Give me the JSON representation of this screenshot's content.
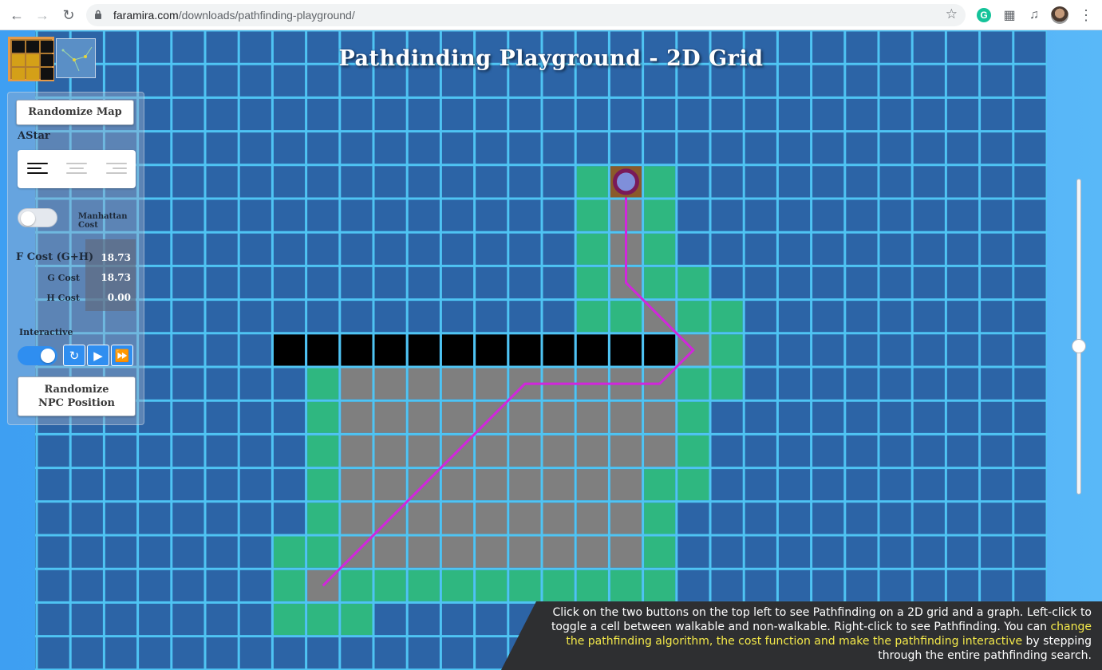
{
  "browser": {
    "url_domain": "faramira.com",
    "url_path": "/downloads/pathfinding-playground/",
    "extension_g": "G"
  },
  "page": {
    "title": "Pathdinding Playground - 2D Grid"
  },
  "panel": {
    "randomize_map_label": "Randomize Map",
    "algorithm_label": "AStar",
    "algorithm_selected": "left",
    "manhattan_label": "Manhattan Cost",
    "manhattan_enabled": false,
    "f_cost_label": "F Cost (G+H)",
    "g_cost_label": "G Cost",
    "h_cost_label": "H Cost",
    "f_cost_value": "18.73",
    "g_cost_value": "18.73",
    "h_cost_value": "0.00",
    "interactive_label": "Interactive",
    "interactive_enabled": true,
    "randomize_npc_line1": "Randomize",
    "randomize_npc_line2": "NPC Position"
  },
  "info": {
    "text_1": "Click on the two buttons on the top left to see Pathfinding on a 2D grid and a graph. Left-click to toggle a cell between walkable and non-walkable. Right-click to see Pathfinding. You can ",
    "text_highlight": "change the pathfinding algorithm, the cost function and make the pathfinding interactive",
    "text_2": " by stepping through the entire pathfinding search."
  },
  "colors": {
    "walkable": "#2c64a6",
    "open": "#2fb780",
    "closed": "#7f7f7f",
    "wall": "#000000",
    "grid_line": "#4fc4f3",
    "path": "#d126dc",
    "npc_fill": "#7f8fda",
    "npc_ring": "#7a1a58"
  },
  "grid": {
    "cols": 30,
    "rows": 19,
    "open": [
      [
        16,
        4
      ],
      [
        18,
        4
      ],
      [
        16,
        5
      ],
      [
        18,
        5
      ],
      [
        16,
        6
      ],
      [
        18,
        6
      ],
      [
        16,
        7
      ],
      [
        18,
        7
      ],
      [
        19,
        7
      ],
      [
        16,
        8
      ],
      [
        17,
        8
      ],
      [
        19,
        8
      ],
      [
        20,
        8
      ],
      [
        19,
        9
      ],
      [
        20,
        9
      ],
      [
        8,
        10
      ],
      [
        19,
        10
      ],
      [
        20,
        10
      ],
      [
        8,
        11
      ],
      [
        19,
        11
      ],
      [
        8,
        12
      ],
      [
        19,
        12
      ],
      [
        8,
        13
      ],
      [
        18,
        13
      ],
      [
        19,
        13
      ],
      [
        8,
        14
      ],
      [
        18,
        14
      ],
      [
        7,
        15
      ],
      [
        8,
        15
      ],
      [
        18,
        15
      ],
      [
        7,
        16
      ],
      [
        9,
        16
      ],
      [
        10,
        16
      ],
      [
        11,
        16
      ],
      [
        12,
        16
      ],
      [
        13,
        16
      ],
      [
        14,
        16
      ],
      [
        15,
        16
      ],
      [
        16,
        16
      ],
      [
        17,
        16
      ],
      [
        18,
        16
      ],
      [
        7,
        17
      ],
      [
        8,
        17
      ],
      [
        9,
        17
      ]
    ],
    "closed": [
      [
        17,
        5
      ],
      [
        17,
        6
      ],
      [
        17,
        7
      ],
      [
        18,
        8
      ],
      [
        19,
        9
      ],
      [
        9,
        10
      ],
      [
        10,
        10
      ],
      [
        11,
        10
      ],
      [
        12,
        10
      ],
      [
        13,
        10
      ],
      [
        14,
        10
      ],
      [
        15,
        10
      ],
      [
        16,
        10
      ],
      [
        17,
        10
      ],
      [
        18,
        10
      ],
      [
        9,
        11
      ],
      [
        10,
        11
      ],
      [
        11,
        11
      ],
      [
        12,
        11
      ],
      [
        13,
        11
      ],
      [
        14,
        11
      ],
      [
        15,
        11
      ],
      [
        16,
        11
      ],
      [
        17,
        11
      ],
      [
        18,
        11
      ],
      [
        9,
        12
      ],
      [
        10,
        12
      ],
      [
        11,
        12
      ],
      [
        12,
        12
      ],
      [
        13,
        12
      ],
      [
        14,
        12
      ],
      [
        15,
        12
      ],
      [
        16,
        12
      ],
      [
        17,
        12
      ],
      [
        18,
        12
      ],
      [
        9,
        13
      ],
      [
        10,
        13
      ],
      [
        11,
        13
      ],
      [
        12,
        13
      ],
      [
        13,
        13
      ],
      [
        14,
        13
      ],
      [
        15,
        13
      ],
      [
        16,
        13
      ],
      [
        17,
        13
      ],
      [
        9,
        14
      ],
      [
        10,
        14
      ],
      [
        11,
        14
      ],
      [
        12,
        14
      ],
      [
        13,
        14
      ],
      [
        14,
        14
      ],
      [
        15,
        14
      ],
      [
        16,
        14
      ],
      [
        17,
        14
      ],
      [
        9,
        15
      ],
      [
        10,
        15
      ],
      [
        11,
        15
      ],
      [
        12,
        15
      ],
      [
        13,
        15
      ],
      [
        14,
        15
      ],
      [
        15,
        15
      ],
      [
        16,
        15
      ],
      [
        17,
        15
      ],
      [
        8,
        16
      ]
    ],
    "walls": [
      [
        7,
        9
      ],
      [
        8,
        9
      ],
      [
        9,
        9
      ],
      [
        10,
        9
      ],
      [
        11,
        9
      ],
      [
        12,
        9
      ],
      [
        13,
        9
      ],
      [
        14,
        9
      ],
      [
        15,
        9
      ],
      [
        16,
        9
      ],
      [
        17,
        9
      ],
      [
        18,
        9
      ]
    ],
    "npc": [
      17,
      4
    ],
    "path": [
      [
        17,
        4
      ],
      [
        17,
        7
      ],
      [
        19,
        9
      ],
      [
        18,
        10
      ],
      [
        14,
        10
      ],
      [
        8,
        16
      ]
    ]
  }
}
